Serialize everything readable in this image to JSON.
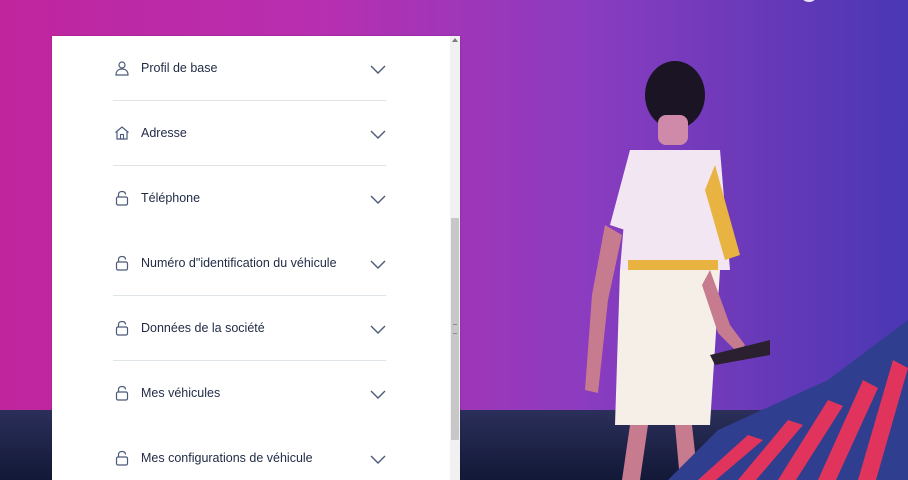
{
  "accordion": {
    "items": [
      {
        "label": "Profil de base",
        "icon": "user-icon"
      },
      {
        "label": "Adresse",
        "icon": "home-icon"
      },
      {
        "label": "Téléphone",
        "icon": "unlock-icon"
      },
      {
        "label": "Numéro d\"identification du véhicule",
        "icon": "unlock-icon"
      },
      {
        "label": "Données de la société",
        "icon": "unlock-icon"
      },
      {
        "label": "Mes véhicules",
        "icon": "unlock-icon"
      },
      {
        "label": "Mes configurations de véhicule",
        "icon": "unlock-icon"
      }
    ]
  },
  "colors": {
    "background_left": "#c0259e",
    "background_right": "#4a37b3",
    "text": "#1f2a44",
    "icon": "#4a5a78",
    "divider": "#dfe4e8"
  }
}
